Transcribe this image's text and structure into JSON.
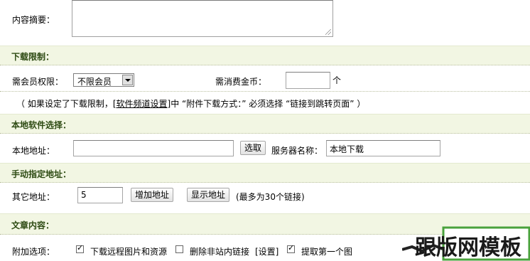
{
  "summary": {
    "label": "内容摘要："
  },
  "download_limit": {
    "section_title": "下载限制：",
    "member_label": "需会员权限：",
    "member_select": "不限会员",
    "coins_label": "需消费金币：",
    "coins_value": "",
    "coins_unit": "个",
    "note_prefix": "（ 如果设定了下载限制，[",
    "note_link": "软件频道设置",
    "note_suffix": "]中 “附件下载方式：” 必须选择 “链接到跳转页面” ）"
  },
  "local_software": {
    "section_title": "本地软件选择：",
    "address_label": "本地地址：",
    "address_value": "",
    "select_button": "选取",
    "server_label": "服务器名称：",
    "server_value": "本地下载"
  },
  "manual_address": {
    "section_title": "手动指定地址：",
    "other_label": "其它地址：",
    "count_value": "5",
    "add_button": "增加地址",
    "show_button": "显示地址",
    "limit_note": "(最多为30个链接)"
  },
  "article": {
    "section_title": "文章内容：",
    "options_label": "附加选项：",
    "opt1_label": "下载远程图片和资源",
    "opt1_checked": true,
    "opt2_label": "删除非站内链接",
    "opt2_checked": false,
    "opt2_setting": "[设置]",
    "opt3_label": "提取第一个图",
    "opt3_checked": true
  },
  "watermark": {
    "text": "跟版网模板"
  }
}
